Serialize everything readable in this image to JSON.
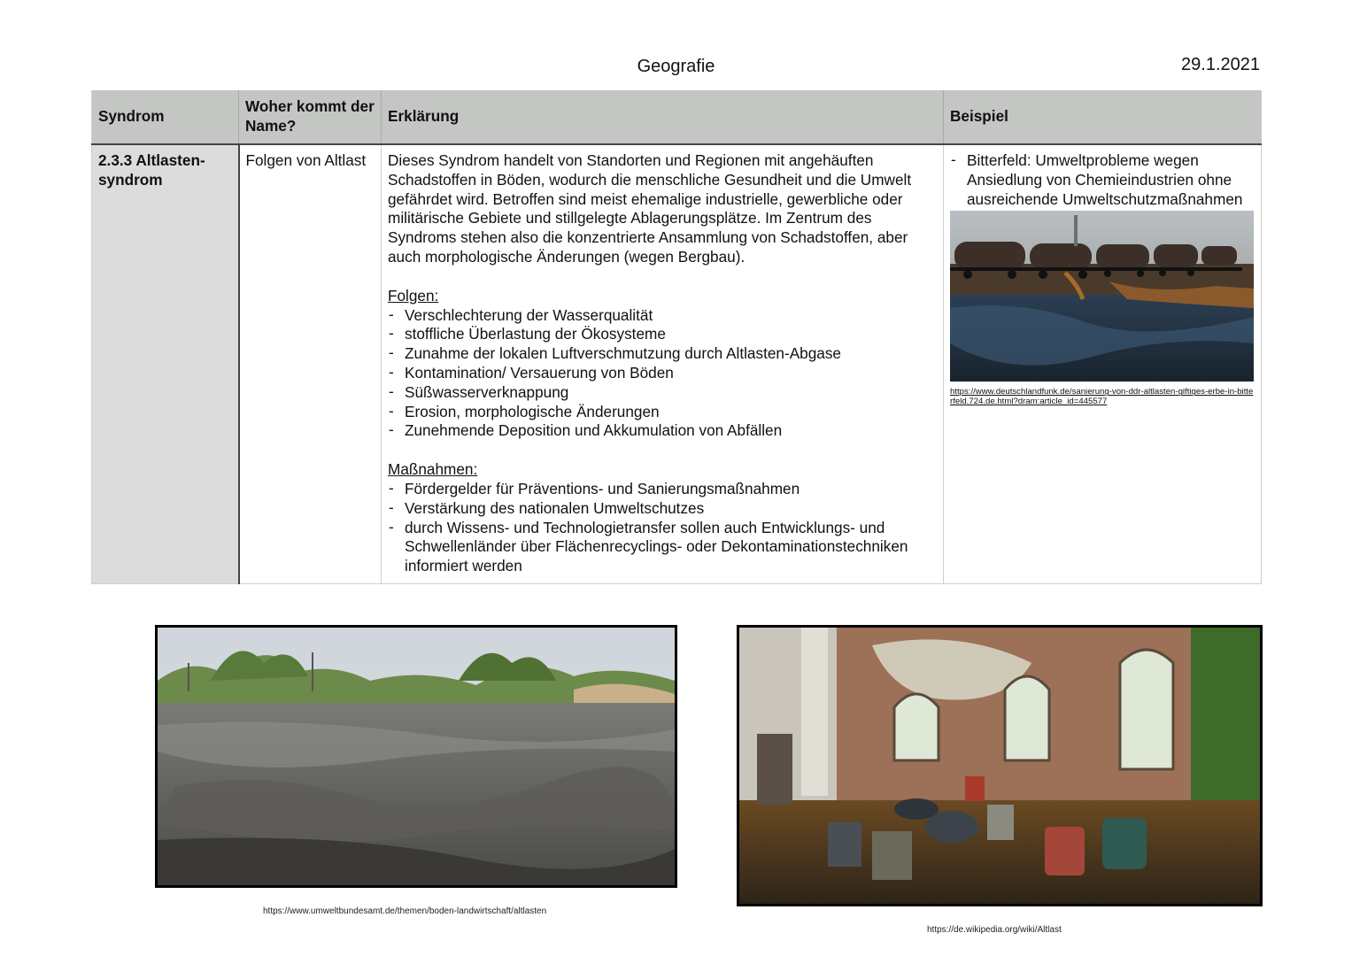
{
  "header": {
    "subject": "Geografie",
    "date": "29.1.2021"
  },
  "table": {
    "headers": [
      "Syndrom",
      "Woher kommt der Name?",
      "Erklärung",
      "Beispiel"
    ],
    "syndrome": "2.3.3 Altlasten-syndrom",
    "origin": "Folgen von Altlast",
    "explanation": "Dieses Syndrom handelt von Standorten und Regionen mit angehäuften Schadstoffen in Böden, wodurch die menschliche Gesundheit und die Umwelt gefährdet wird. Betroffen sind meist ehemalige industrielle, gewerbliche oder militärische Gebiete und stillgelegte Ablagerungsplätze. Im Zentrum des Syndroms stehen also die konzentrierte Ansammlung von Schadstoffen, aber auch morphologische Änderungen (wegen Bergbau).",
    "folgen_title": "Folgen:",
    "folgen": [
      "Verschlechterung der Wasserqualität",
      "stoffliche Überlastung der Ökosysteme",
      "Zunahme der lokalen Luftverschmutzung durch Altlasten-Abgase",
      "Kontamination/ Versauerung von Böden",
      "Süßwasserverknappung",
      "Erosion, morphologische Änderungen",
      "Zunehmende Deposition und Akkumulation von Abfällen"
    ],
    "massnahmen_title": "Maßnahmen:",
    "massnahmen": [
      "Fördergelder für Präventions- und Sanierungsmaßnahmen",
      "Verstärkung des nationalen Umweltschutzes",
      "durch Wissens- und Technologietransfer sollen auch Entwicklungs- und Schwellenländer über Flächenrecyclings- oder Dekontaminationstechniken informiert werden"
    ],
    "example": "Bitterfeld: Umweltprobleme wegen Ansiedlung von Chemieindustrien ohne ausreichende Umweltschutzmaßnahmen",
    "example_source": "https://www.deutschlandfunk.de/sanierung-von-ddr-altlasten-giftiges-erbe-in-bitterfeld.724.de.html?dram:article_id=445577"
  },
  "photos": {
    "left_source": "https://www.umweltbundesamt.de/themen/boden-landwirtschaft/altlasten",
    "right_source": "https://de.wikipedia.org/wiki/Altlast"
  }
}
